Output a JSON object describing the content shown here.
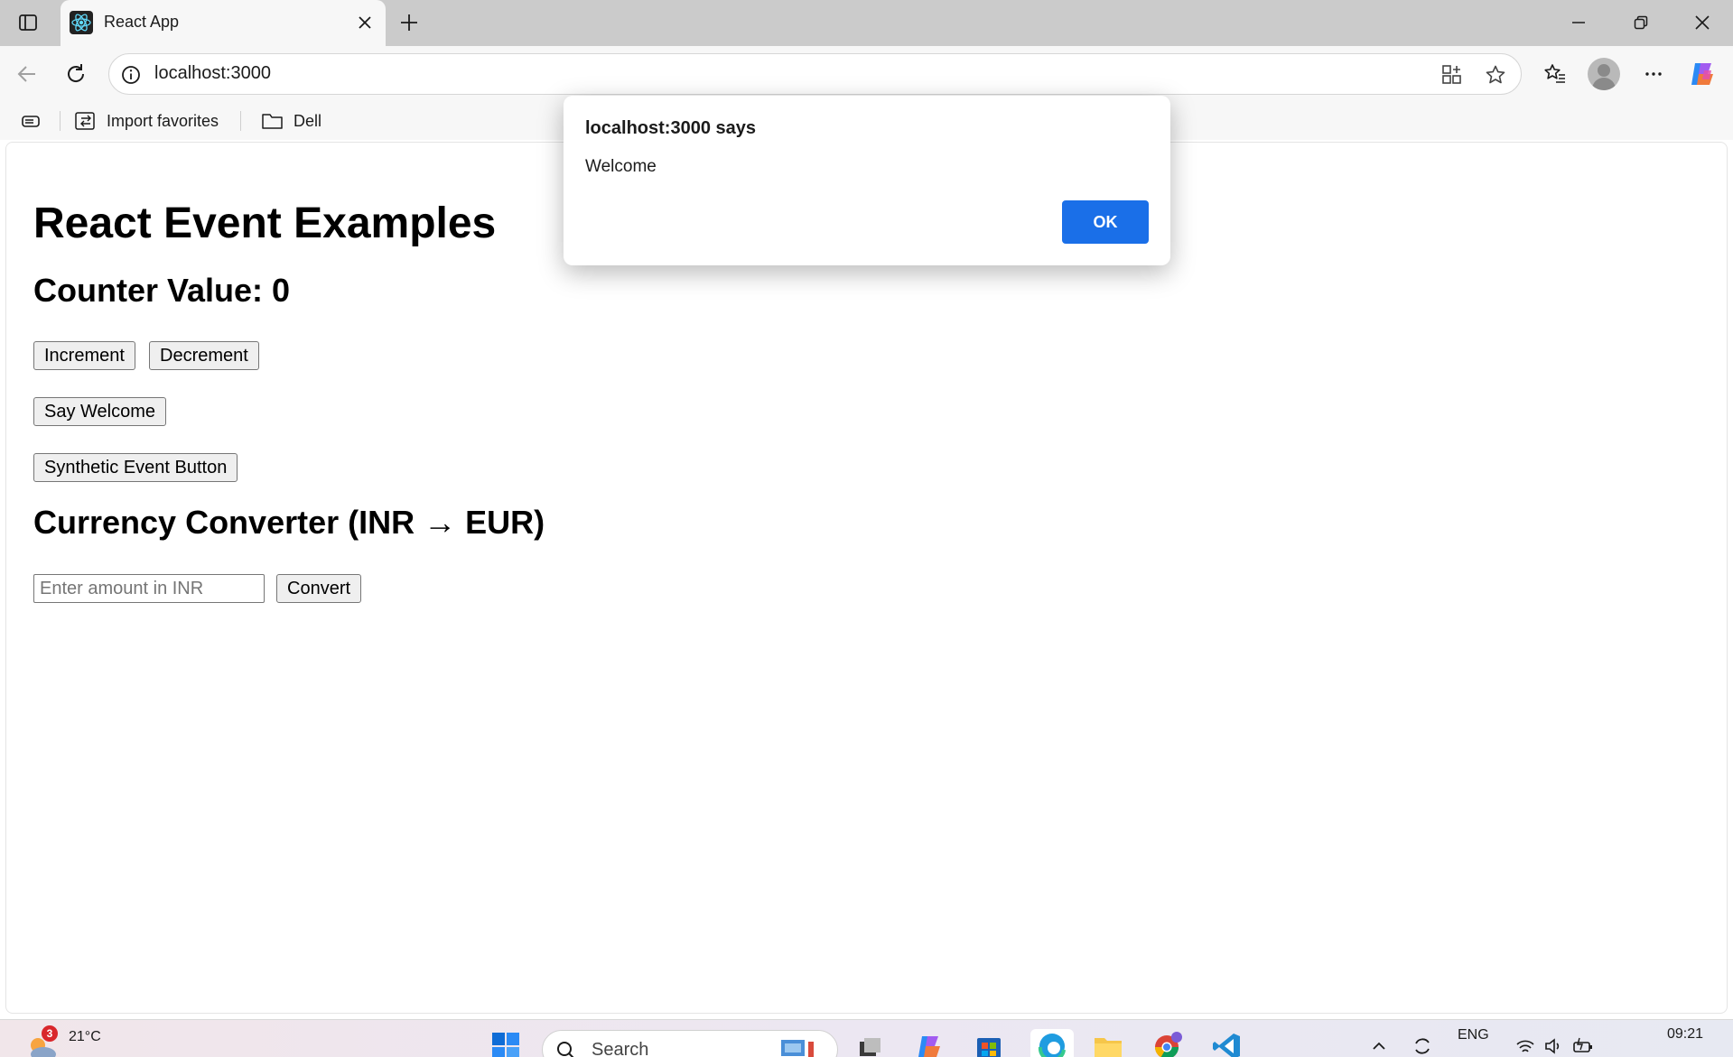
{
  "browser": {
    "tab_title": "React App",
    "url": "localhost:3000",
    "favorites": [
      {
        "label": "Import favorites",
        "icon": "import-favorites-icon"
      },
      {
        "label": "Dell",
        "icon": "folder-icon"
      }
    ]
  },
  "page": {
    "title": "React Event Examples",
    "counter_heading": "Counter Value: 0",
    "increment_label": "Increment",
    "decrement_label": "Decrement",
    "welcome_label": "Say Welcome",
    "synthetic_label": "Synthetic Event Button",
    "currency_heading": "Currency Converter (INR → EUR)",
    "amount_placeholder": "Enter amount in INR",
    "convert_label": "Convert"
  },
  "dialog": {
    "title": "localhost:3000 says",
    "message": "Welcome",
    "ok_label": "OK",
    "accent": "#1a6fe8"
  },
  "taskbar": {
    "weather_temp": "21°C",
    "weather_badge": "3",
    "search_placeholder": "Search",
    "language": "ENG",
    "time": "09:21"
  }
}
